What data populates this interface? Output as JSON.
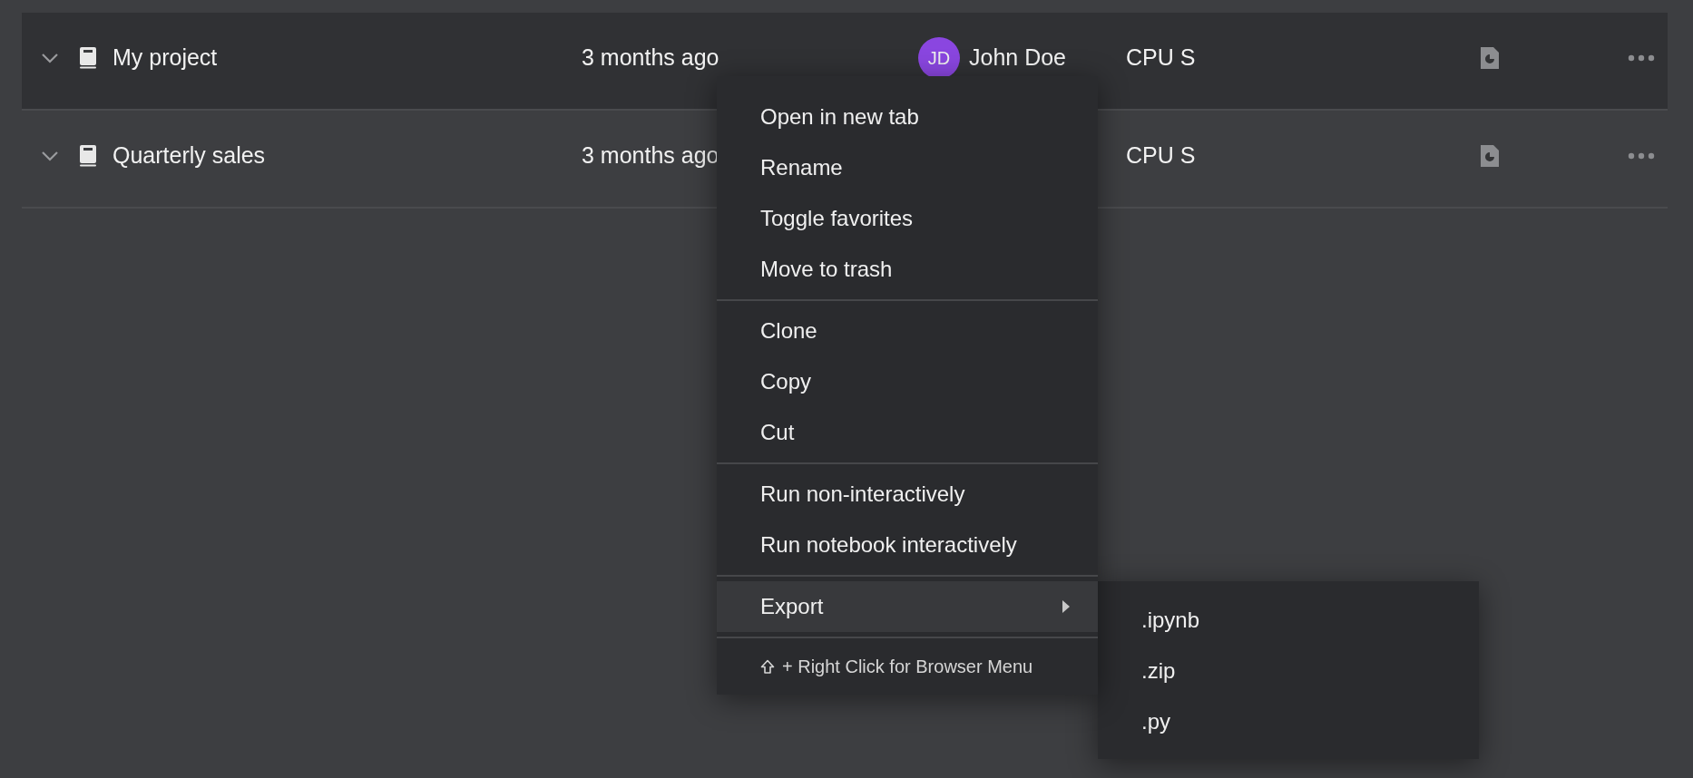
{
  "rows": [
    {
      "name": "My project",
      "modified": "3 months ago",
      "owner": {
        "initials": "JD",
        "name": "John Doe"
      },
      "compute": "CPU S",
      "selected": true
    },
    {
      "name": "Quarterly sales",
      "modified": "3 months ago",
      "compute": "CPU S",
      "selected": false
    }
  ],
  "context_menu": {
    "groups": [
      [
        "Open in new tab",
        "Rename",
        "Toggle favorites",
        "Move to trash"
      ],
      [
        "Clone",
        "Copy",
        "Cut"
      ],
      [
        "Run non-interactively",
        "Run notebook interactively"
      ],
      [
        {
          "label": "Export",
          "selected": true,
          "submenu": [
            ".ipynb",
            ".zip",
            ".py"
          ]
        }
      ]
    ],
    "hint": "+ Right Click for Browser Menu"
  }
}
